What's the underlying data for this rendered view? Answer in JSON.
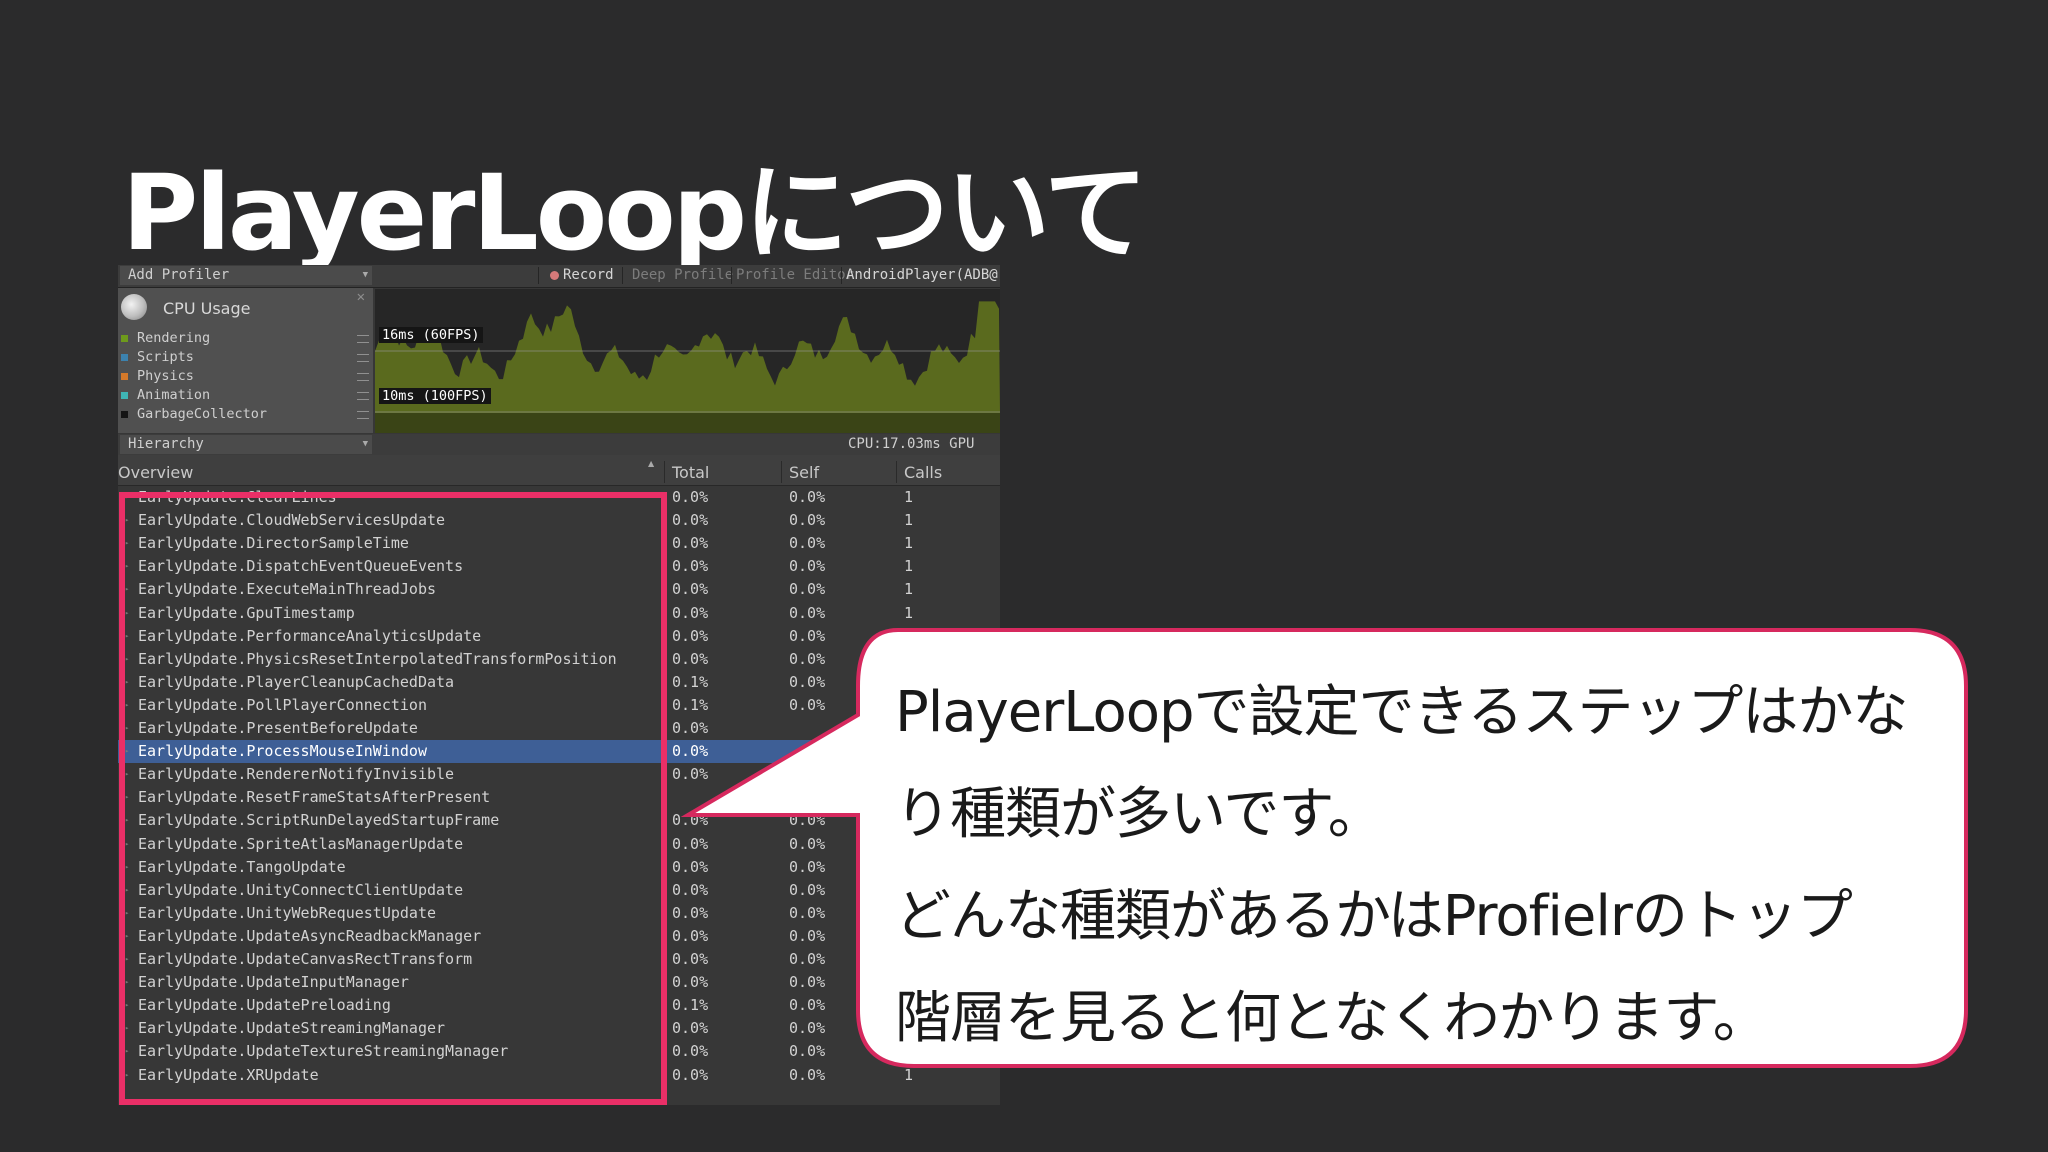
{
  "slide": {
    "title": "PlayerLoopについて"
  },
  "profiler": {
    "toolbar": {
      "add_profiler": "Add Profiler",
      "record": "Record",
      "deep_profile": "Deep Profile",
      "profile_editor": "Profile Editor",
      "target": "AndroidPlayer(ADB@"
    },
    "module": {
      "title": "CPU Usage",
      "legend": [
        {
          "label": "Rendering",
          "color": "#6e9a1c"
        },
        {
          "label": "Scripts",
          "color": "#3c82ae"
        },
        {
          "label": "Physics",
          "color": "#d4792a"
        },
        {
          "label": "Animation",
          "color": "#3fb5b5"
        },
        {
          "label": "GarbageCollector",
          "color": "#151515"
        }
      ]
    },
    "chart": {
      "fps60_label": "16ms (60FPS)",
      "fps100_label": "10ms (100FPS)",
      "area_color": "#5a6a1e"
    },
    "hierarchy_bar": {
      "view_mode": "Hierarchy",
      "cpu_time": "CPU:17.03ms  GPU"
    },
    "columns": {
      "overview": "Overview",
      "total": "Total",
      "self": "Self",
      "calls": "Calls"
    },
    "rows": [
      {
        "name": "EarlyUpdate.ClearLines",
        "total": "0.0%",
        "self": "0.0%",
        "calls": "1"
      },
      {
        "name": "EarlyUpdate.CloudWebServicesUpdate",
        "total": "0.0%",
        "self": "0.0%",
        "calls": "1"
      },
      {
        "name": "EarlyUpdate.DirectorSampleTime",
        "total": "0.0%",
        "self": "0.0%",
        "calls": "1"
      },
      {
        "name": "EarlyUpdate.DispatchEventQueueEvents",
        "total": "0.0%",
        "self": "0.0%",
        "calls": "1"
      },
      {
        "name": "EarlyUpdate.ExecuteMainThreadJobs",
        "total": "0.0%",
        "self": "0.0%",
        "calls": "1"
      },
      {
        "name": "EarlyUpdate.GpuTimestamp",
        "total": "0.0%",
        "self": "0.0%",
        "calls": "1"
      },
      {
        "name": "EarlyUpdate.PerformanceAnalyticsUpdate",
        "total": "0.0%",
        "self": "0.0%",
        "calls": ""
      },
      {
        "name": "EarlyUpdate.PhysicsResetInterpolatedTransformPosition",
        "total": "0.0%",
        "self": "0.0%",
        "calls": ""
      },
      {
        "name": "EarlyUpdate.PlayerCleanupCachedData",
        "total": "0.1%",
        "self": "0.0%",
        "calls": ""
      },
      {
        "name": "EarlyUpdate.PollPlayerConnection",
        "total": "0.1%",
        "self": "0.0%",
        "calls": ""
      },
      {
        "name": "EarlyUpdate.PresentBeforeUpdate",
        "total": "0.0%",
        "self": "",
        "calls": ""
      },
      {
        "name": "EarlyUpdate.ProcessMouseInWindow",
        "total": "0.0%",
        "self": "",
        "calls": ""
      },
      {
        "name": "EarlyUpdate.RendererNotifyInvisible",
        "total": "0.0%",
        "self": "",
        "calls": ""
      },
      {
        "name": "EarlyUpdate.ResetFrameStatsAfterPresent",
        "total": "",
        "self": "",
        "calls": ""
      },
      {
        "name": "EarlyUpdate.ScriptRunDelayedStartupFrame",
        "total": "0.0%",
        "self": "0.0%",
        "calls": ""
      },
      {
        "name": "EarlyUpdate.SpriteAtlasManagerUpdate",
        "total": "0.0%",
        "self": "0.0%",
        "calls": ""
      },
      {
        "name": "EarlyUpdate.TangoUpdate",
        "total": "0.0%",
        "self": "0.0%",
        "calls": ""
      },
      {
        "name": "EarlyUpdate.UnityConnectClientUpdate",
        "total": "0.0%",
        "self": "0.0%",
        "calls": ""
      },
      {
        "name": "EarlyUpdate.UnityWebRequestUpdate",
        "total": "0.0%",
        "self": "0.0%",
        "calls": ""
      },
      {
        "name": "EarlyUpdate.UpdateAsyncReadbackManager",
        "total": "0.0%",
        "self": "0.0%",
        "calls": ""
      },
      {
        "name": "EarlyUpdate.UpdateCanvasRectTransform",
        "total": "0.0%",
        "self": "0.0%",
        "calls": ""
      },
      {
        "name": "EarlyUpdate.UpdateInputManager",
        "total": "0.0%",
        "self": "0.0%",
        "calls": ""
      },
      {
        "name": "EarlyUpdate.UpdatePreloading",
        "total": "0.1%",
        "self": "0.0%",
        "calls": ""
      },
      {
        "name": "EarlyUpdate.UpdateStreamingManager",
        "total": "0.0%",
        "self": "0.0%",
        "calls": ""
      },
      {
        "name": "EarlyUpdate.UpdateTextureStreamingManager",
        "total": "0.0%",
        "self": "0.0%",
        "calls": "1"
      },
      {
        "name": "EarlyUpdate.XRUpdate",
        "total": "0.0%",
        "self": "0.0%",
        "calls": "1"
      }
    ],
    "selected_row_index": 11
  },
  "callout": {
    "lines": [
      "PlayerLoopで設定できるステップはかな",
      "り種類が多いです。",
      "どんな種類があるかはProfielrのトップ",
      "階層を見ると何となくわかります。"
    ],
    "border_color": "#d6295e",
    "fill_color": "#ffffff"
  },
  "highlight": {
    "color": "#ea2f67"
  }
}
